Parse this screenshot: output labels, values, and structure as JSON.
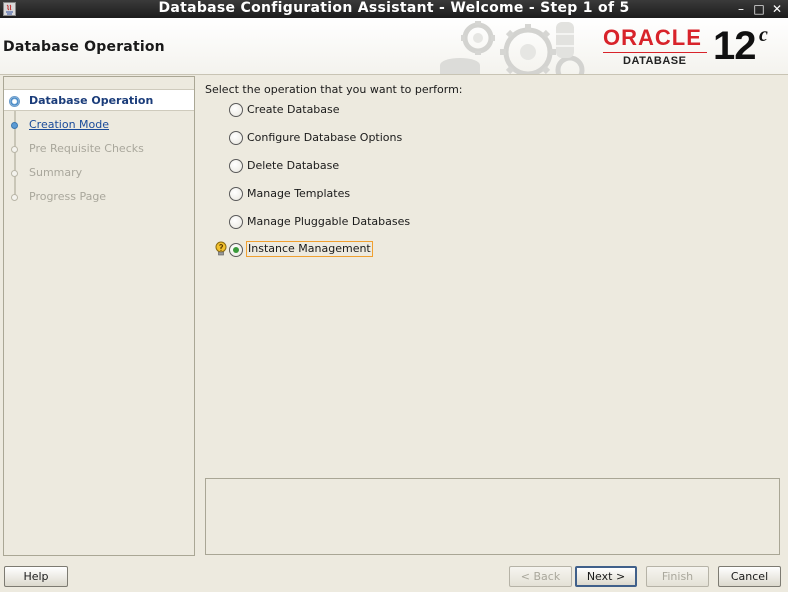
{
  "window": {
    "title": "Database Configuration Assistant - Welcome - Step 1 of 5",
    "minimize_glyph": "–",
    "maximize_glyph": "□",
    "close_glyph": "✕"
  },
  "header": {
    "page_title": "Database Operation",
    "logo_text": "ORACLE",
    "logo_sub": "DATABASE",
    "version": "12",
    "version_sup": "c"
  },
  "nav": {
    "items": [
      {
        "label": "Database Operation",
        "state": "current"
      },
      {
        "label": "Creation Mode",
        "state": "active"
      },
      {
        "label": "Pre Requisite Checks",
        "state": "disabled"
      },
      {
        "label": "Summary",
        "state": "disabled"
      },
      {
        "label": "Progress Page",
        "state": "disabled"
      }
    ]
  },
  "main": {
    "prompt": "Select the operation that you want to perform:",
    "options": [
      {
        "label": "Create Database",
        "selected": false
      },
      {
        "label": "Configure Database Options",
        "selected": false
      },
      {
        "label": "Delete Database",
        "selected": false
      },
      {
        "label": "Manage Templates",
        "selected": false
      },
      {
        "label": "Manage Pluggable Databases",
        "selected": false
      },
      {
        "label": "Instance Management",
        "selected": true
      }
    ]
  },
  "buttons": {
    "help": "Help",
    "back": "< Back",
    "next": "Next >",
    "finish": "Finish",
    "cancel": "Cancel"
  },
  "colors": {
    "oracle_red": "#d8232a",
    "nav_current": "#1a3c7a",
    "nav_link": "#1a4b9a",
    "focus_border": "#f0a030"
  }
}
